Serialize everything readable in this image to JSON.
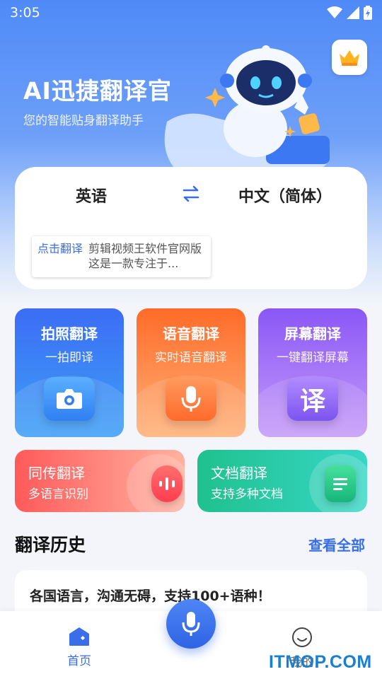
{
  "status_bar": {
    "time": "3:05"
  },
  "header": {
    "title": "AI迅捷翻译官",
    "subtitle": "您的智能贴身翻译助手",
    "vip_icon": "crown-icon"
  },
  "translator": {
    "source_lang": "英语",
    "target_lang": "中文（简体）",
    "swap_icon": "swap-arrows-icon",
    "hint_link": "点击翻译",
    "hint_text": "剪辑视频王软件官网版这是一款专注于..."
  },
  "features": [
    {
      "title": "拍照翻译",
      "subtitle": "一拍即译",
      "icon": "camera-icon"
    },
    {
      "title": "语音翻译",
      "subtitle": "实时语音翻译",
      "icon": "microphone-icon"
    },
    {
      "title": "屏幕翻译",
      "subtitle": "一键翻译屏幕",
      "icon": "translate-char-icon",
      "icon_glyph": "译"
    }
  ],
  "wide_features": [
    {
      "title": "同传翻译",
      "subtitle": "多语言识别",
      "icon": "voice-wave-icon"
    },
    {
      "title": "文档翻译",
      "subtitle": "支持多种文档",
      "icon": "document-icon"
    }
  ],
  "history": {
    "title": "翻译历史",
    "view_all": "查看全部",
    "items": [
      "各国语言，沟通无碍，支持100+语种！"
    ]
  },
  "bottom_nav": {
    "home_label": "首页",
    "me_label": "我的",
    "active": "home"
  },
  "watermark": "ITMOP.COM",
  "colors": {
    "accent": "#3a6ee8",
    "hero": "#4f8af7"
  }
}
